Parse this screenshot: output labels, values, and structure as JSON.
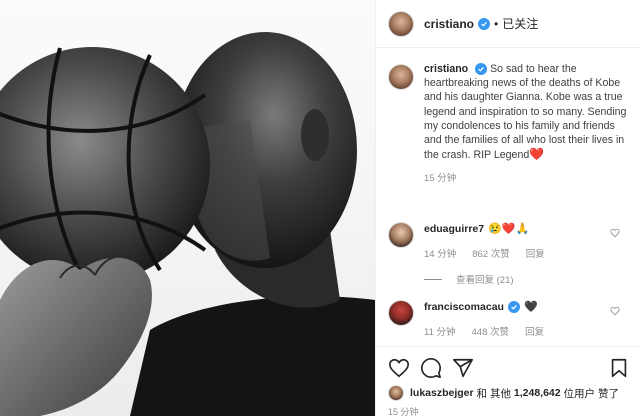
{
  "header": {
    "username": "cristiano",
    "separator": "•",
    "follow_status": "已关注"
  },
  "caption": {
    "username": "cristiano",
    "text": "So sad to hear the heartbreaking news of the deaths of Kobe and his daughter Gianna. Kobe was a true legend and inspiration to so many. Sending my condolences to his family and friends and the families of all who lost their lives in the crash. RIP Legend",
    "emoji": "❤️",
    "time": "15 分钟"
  },
  "comments": [
    {
      "username": "eduaguirre7",
      "emojis": "😢❤️🙏",
      "time": "14 分钟",
      "likes": "862 次赞",
      "reply_label": "回复",
      "view_replies": "查看回复 (21)"
    },
    {
      "username": "franciscomacau",
      "emojis": "🖤",
      "time": "11 分钟",
      "likes": "448 次赞",
      "reply_label": "回复"
    }
  ],
  "likes_line": {
    "liker": "lukaszbejger",
    "connector": "和 其他",
    "count": "1,248,642",
    "suffix": "位用户 赞了"
  },
  "footer_time": "15 分钟",
  "colors": {
    "verified": "#3897f0",
    "heart": "#ed4956",
    "meta_gray": "#8e8e8e"
  },
  "icons": [
    "heart-icon",
    "comment-icon",
    "share-icon",
    "bookmark-icon",
    "verified-icon",
    "small-heart-icon"
  ]
}
